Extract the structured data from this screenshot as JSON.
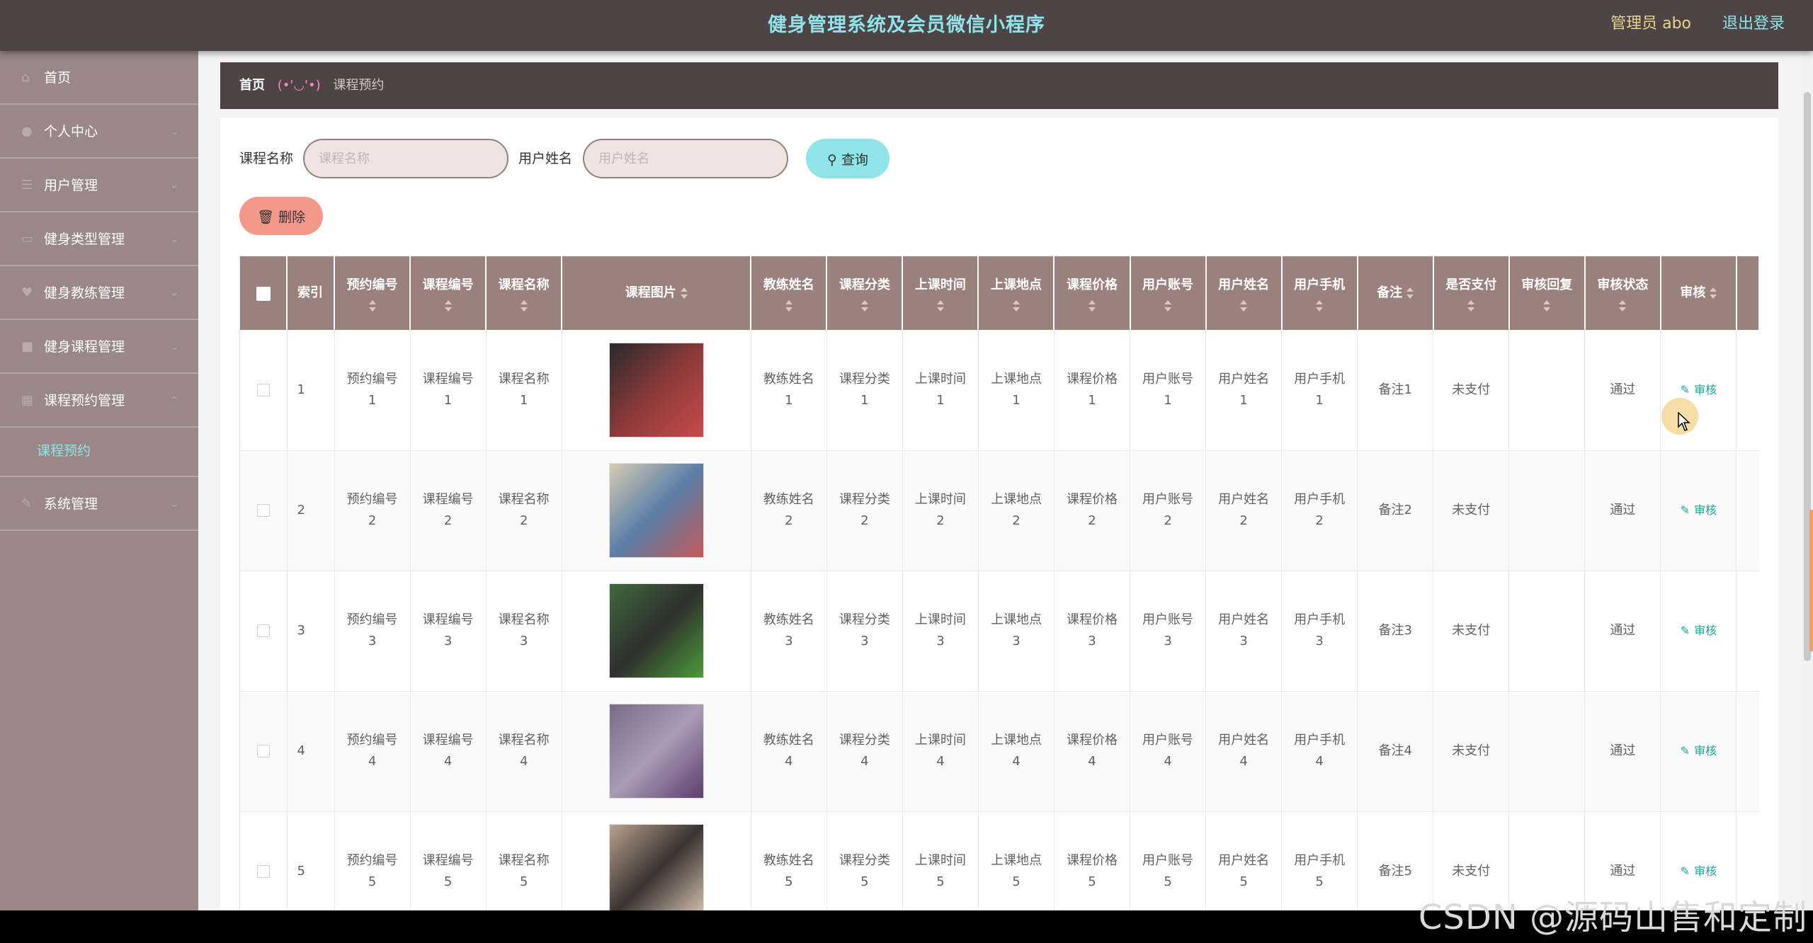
{
  "header": {
    "title": "健身管理系统及会员微信小程序",
    "admin": "管理员 abo",
    "logout": "退出登录"
  },
  "sidebar": {
    "items": [
      {
        "label": "首页",
        "icon": "home-icon",
        "arrow": false
      },
      {
        "label": "个人中心",
        "icon": "user-icon",
        "arrow": true
      },
      {
        "label": "用户管理",
        "icon": "list-icon",
        "arrow": true
      },
      {
        "label": "健身类型管理",
        "icon": "doc-icon",
        "arrow": true
      },
      {
        "label": "健身教练管理",
        "icon": "heart-icon",
        "arrow": true
      },
      {
        "label": "健身课程管理",
        "icon": "book-icon",
        "arrow": true
      },
      {
        "label": "课程预约管理",
        "icon": "grid-icon",
        "arrow": true
      }
    ],
    "sub_item": "课程预约",
    "last_item": {
      "label": "系统管理",
      "icon": "wrench-icon",
      "arrow": true
    }
  },
  "breadcrumb": {
    "home": "首页",
    "separator": "(•'◡'•)",
    "current": "课程预约"
  },
  "search": {
    "course_label": "课程名称",
    "course_placeholder": "课程名称",
    "user_label": "用户姓名",
    "user_placeholder": "用户姓名",
    "query_button": "查询",
    "delete_button": "删除"
  },
  "table": {
    "headers": [
      "索引",
      "预约编号",
      "课程编号",
      "课程名称",
      "课程图片",
      "教练姓名",
      "课程分类",
      "上课时间",
      "上课地点",
      "课程价格",
      "用户账号",
      "用户姓名",
      "用户手机",
      "备注",
      "是否支付",
      "审核回复",
      "审核状态",
      "审核"
    ],
    "rows": [
      {
        "index": "1",
        "booking_no": "预约编号",
        "booking_no_n": "1",
        "course_no": "课程编号",
        "course_no_n": "1",
        "course_name": "课程名称",
        "course_name_n": "1",
        "coach": "教练姓名",
        "coach_n": "1",
        "category": "课程分类",
        "category_n": "1",
        "time": "上课时间",
        "time_n": "1",
        "place": "上课地点",
        "place_n": "1",
        "price": "课程价格",
        "price_n": "1",
        "account": "用户账号",
        "account_n": "1",
        "user_name": "用户姓名",
        "user_name_n": "1",
        "phone": "用户手机",
        "phone_n": "1",
        "remark": "备注1",
        "paid": "未支付",
        "reply": "",
        "status": "通过",
        "action": "审核"
      },
      {
        "index": "2",
        "booking_no": "预约编号",
        "booking_no_n": "2",
        "course_no": "课程编号",
        "course_no_n": "2",
        "course_name": "课程名称",
        "course_name_n": "2",
        "coach": "教练姓名",
        "coach_n": "2",
        "category": "课程分类",
        "category_n": "2",
        "time": "上课时间",
        "time_n": "2",
        "place": "上课地点",
        "place_n": "2",
        "price": "课程价格",
        "price_n": "2",
        "account": "用户账号",
        "account_n": "2",
        "user_name": "用户姓名",
        "user_name_n": "2",
        "phone": "用户手机",
        "phone_n": "2",
        "remark": "备注2",
        "paid": "未支付",
        "reply": "",
        "status": "通过",
        "action": "审核"
      },
      {
        "index": "3",
        "booking_no": "预约编号",
        "booking_no_n": "3",
        "course_no": "课程编号",
        "course_no_n": "3",
        "course_name": "课程名称",
        "course_name_n": "3",
        "coach": "教练姓名",
        "coach_n": "3",
        "category": "课程分类",
        "category_n": "3",
        "time": "上课时间",
        "time_n": "3",
        "place": "上课地点",
        "place_n": "3",
        "price": "课程价格",
        "price_n": "3",
        "account": "用户账号",
        "account_n": "3",
        "user_name": "用户姓名",
        "user_name_n": "3",
        "phone": "用户手机",
        "phone_n": "3",
        "remark": "备注3",
        "paid": "未支付",
        "reply": "",
        "status": "通过",
        "action": "审核"
      },
      {
        "index": "4",
        "booking_no": "预约编号",
        "booking_no_n": "4",
        "course_no": "课程编号",
        "course_no_n": "4",
        "course_name": "课程名称",
        "course_name_n": "4",
        "coach": "教练姓名",
        "coach_n": "4",
        "category": "课程分类",
        "category_n": "4",
        "time": "上课时间",
        "time_n": "4",
        "place": "上课地点",
        "place_n": "4",
        "price": "课程价格",
        "price_n": "4",
        "account": "用户账号",
        "account_n": "4",
        "user_name": "用户姓名",
        "user_name_n": "4",
        "phone": "用户手机",
        "phone_n": "4",
        "remark": "备注4",
        "paid": "未支付",
        "reply": "",
        "status": "通过",
        "action": "审核"
      },
      {
        "index": "5",
        "booking_no": "预约编号",
        "booking_no_n": "5",
        "course_no": "课程编号",
        "course_no_n": "5",
        "course_name": "课程名称",
        "course_name_n": "5",
        "coach": "教练姓名",
        "coach_n": "5",
        "category": "课程分类",
        "category_n": "5",
        "time": "上课时间",
        "time_n": "5",
        "place": "上课地点",
        "place_n": "5",
        "price": "课程价格",
        "price_n": "5",
        "account": "用户账号",
        "account_n": "5",
        "user_name": "用户姓名",
        "user_name_n": "5",
        "phone": "用户手机",
        "phone_n": "5",
        "remark": "备注5",
        "paid": "未支付",
        "reply": "",
        "status": "通过",
        "action": "审核"
      }
    ]
  },
  "watermark": "CSDN @源码山售和定制",
  "colors": {
    "header_bg": "#4e4446",
    "title": "#8fe4e9",
    "sidebar_bg": "#9a8886",
    "table_header_bg": "#9b817d",
    "query_button": "#8fe4e9",
    "delete_button": "#f4988c",
    "audit_link": "#17a89a"
  }
}
